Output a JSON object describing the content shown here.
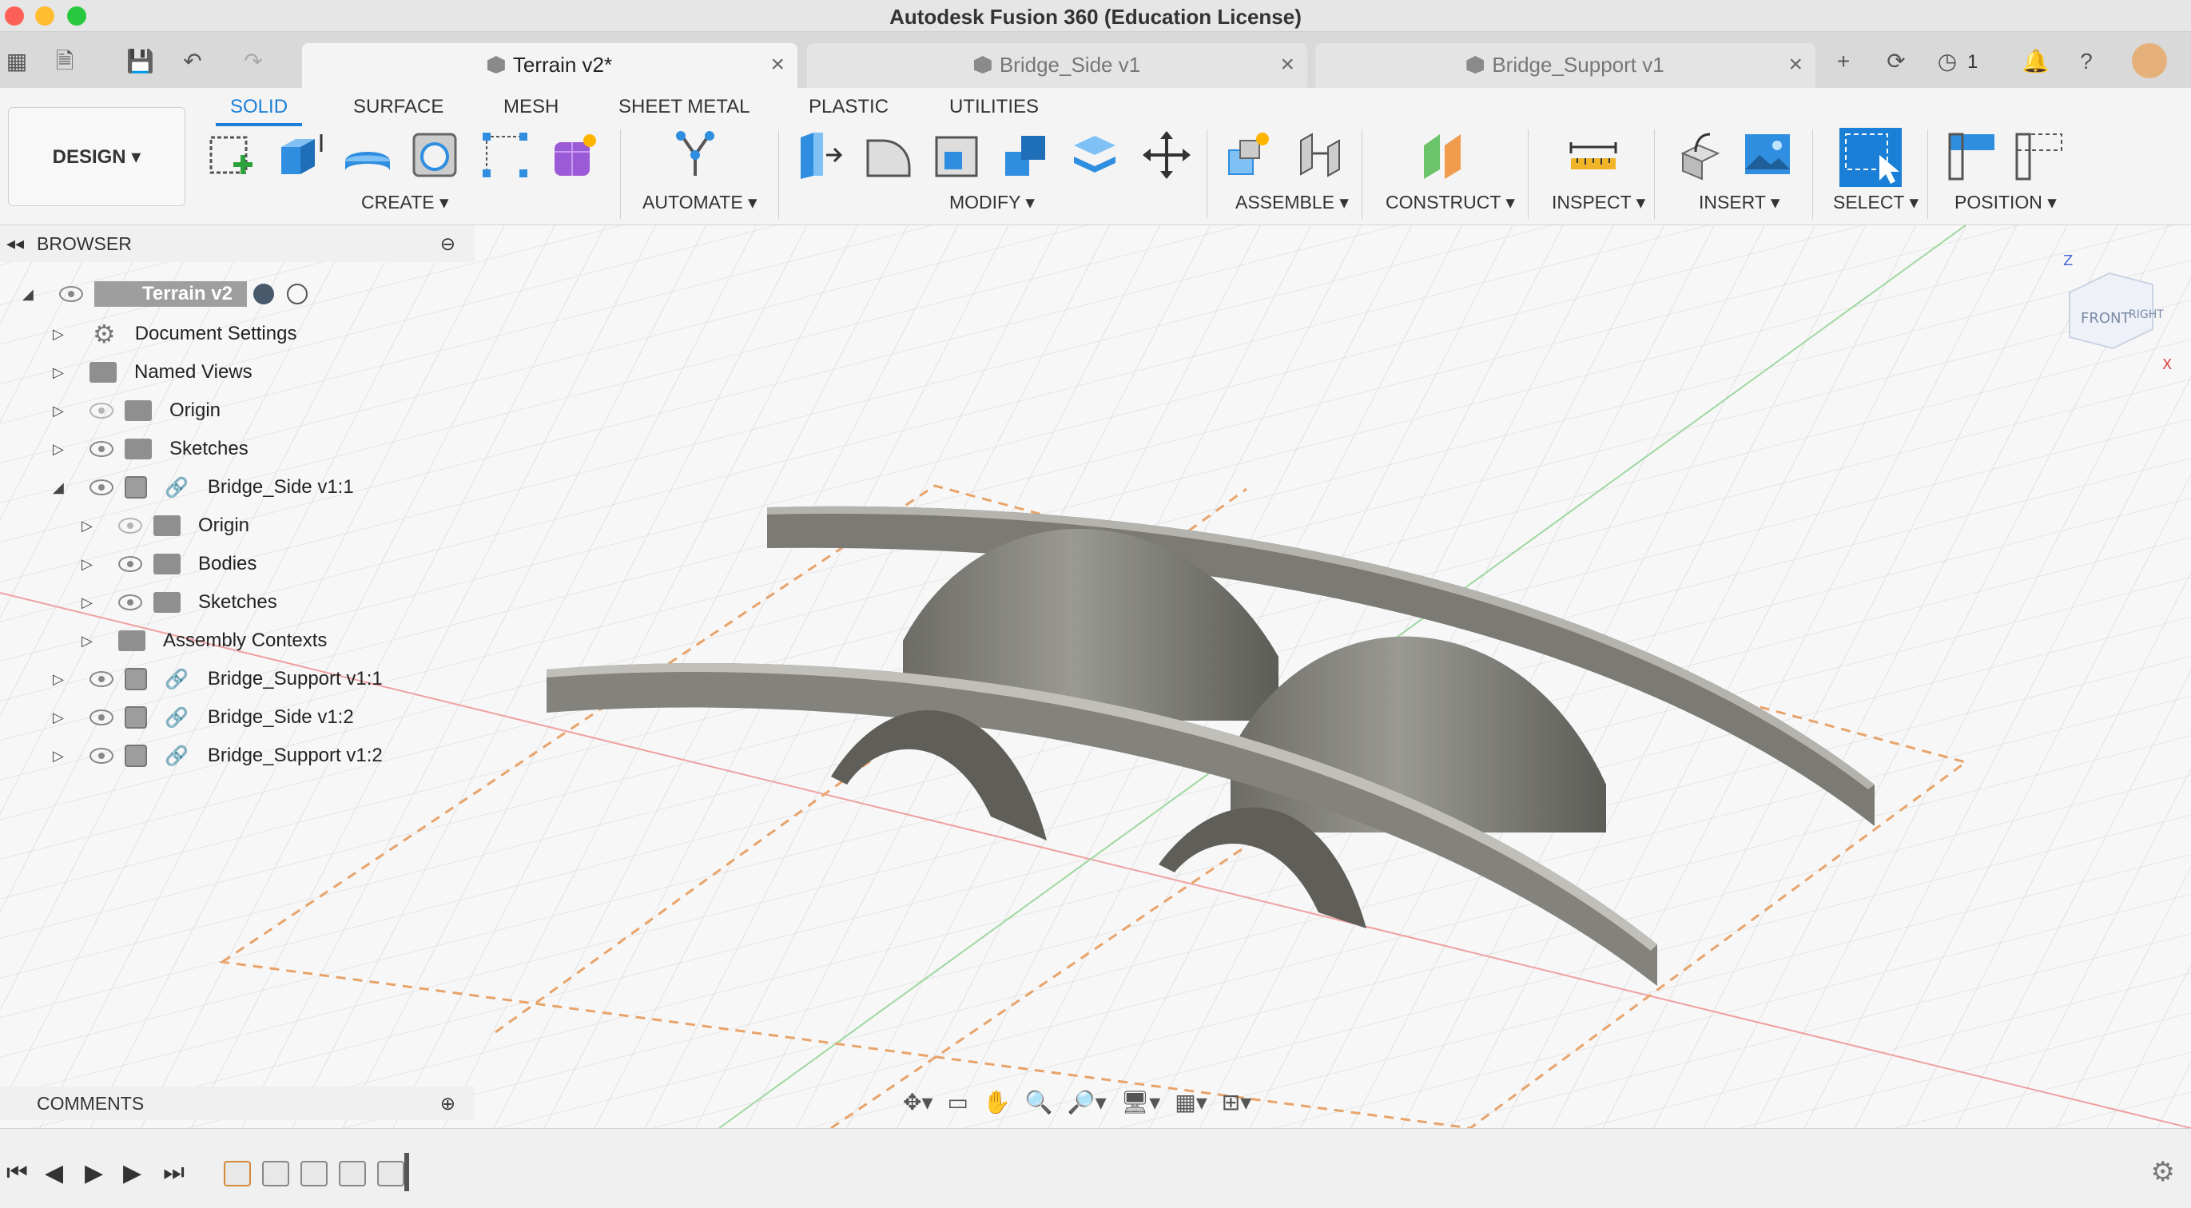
{
  "window": {
    "title": "Autodesk Fusion 360 (Education License)"
  },
  "tabs": [
    {
      "label": "Terrain v2*",
      "active": true
    },
    {
      "label": "Bridge_Side v1",
      "active": false
    },
    {
      "label": "Bridge_Support v1",
      "active": false
    }
  ],
  "topright": {
    "job_count": "1"
  },
  "workspace": {
    "label": "DESIGN ▾"
  },
  "ribbon_tabs": [
    "SOLID",
    "SURFACE",
    "MESH",
    "SHEET METAL",
    "PLASTIC",
    "UTILITIES"
  ],
  "ribbon_groups": [
    "CREATE ▾",
    "AUTOMATE ▾",
    "MODIFY ▾",
    "ASSEMBLE ▾",
    "CONSTRUCT ▾",
    "INSPECT ▾",
    "INSERT ▾",
    "SELECT ▾",
    "POSITION ▾"
  ],
  "browser": {
    "title": "BROWSER",
    "root": "Terrain v2",
    "items": [
      "Document Settings",
      "Named Views",
      "Origin",
      "Sketches",
      "Bridge_Side v1:1",
      "Origin",
      "Bodies",
      "Sketches",
      "Assembly Contexts",
      "Bridge_Support v1:1",
      "Bridge_Side v1:2",
      "Bridge_Support v1:2"
    ]
  },
  "comments": {
    "title": "COMMENTS"
  },
  "viewcube": {
    "front": "FRONT",
    "right": "RIGHT",
    "z": "Z",
    "x": "X"
  },
  "colors": {
    "accent": "#1a7fd6",
    "model": "#7e7d78",
    "sketch_profile": "#e8a36a"
  }
}
